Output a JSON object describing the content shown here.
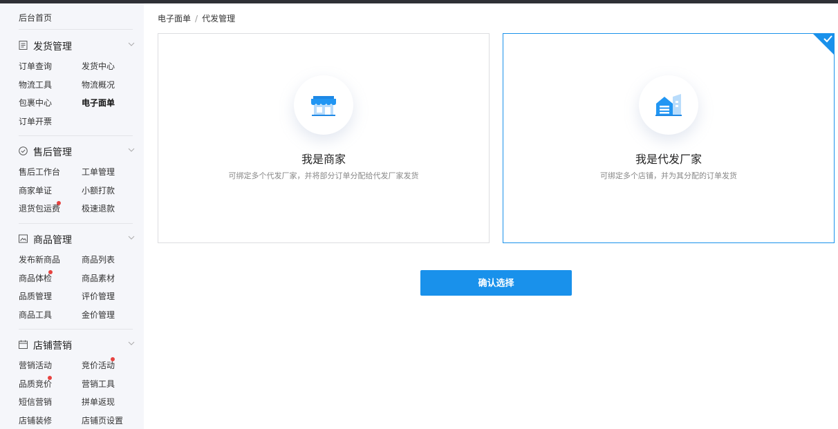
{
  "sidebar": {
    "home": "后台首页",
    "sections": [
      {
        "title": "发货管理",
        "icon": "document-icon",
        "items": [
          "订单查询",
          "发货中心",
          "物流工具",
          "物流概况",
          "包裹中心",
          "电子面单",
          "订单开票"
        ]
      },
      {
        "title": "售后管理",
        "icon": "shield-check-icon",
        "items": [
          "售后工作台",
          "工单管理",
          "商家单证",
          "小额打款",
          "退货包运费",
          "极速退款"
        ]
      },
      {
        "title": "商品管理",
        "icon": "image-icon",
        "items": [
          "发布新商品",
          "商品列表",
          "商品体检",
          "商品素材",
          "品质管理",
          "评价管理",
          "商品工具",
          "金价管理"
        ]
      },
      {
        "title": "店铺营销",
        "icon": "calendar-icon",
        "items": [
          "营销活动",
          "竞价活动",
          "品质竞价",
          "营销工具",
          "短信营销",
          "拼单返现",
          "店铺装修",
          "店铺页设置"
        ]
      }
    ],
    "active_item": "电子面单"
  },
  "breadcrumb": {
    "parent": "电子面单",
    "separator": "/",
    "current": "代发管理"
  },
  "cards": [
    {
      "title": "我是商家",
      "desc": "可绑定多个代发厂家，并将部分订单分配给代发厂家发货",
      "icon": "store-icon",
      "selected": false
    },
    {
      "title": "我是代发厂家",
      "desc": "可绑定多个店铺，并为其分配的订单发货",
      "icon": "factory-icon",
      "selected": true
    }
  ],
  "confirm_button": "确认选择",
  "colors": {
    "accent": "#1991eb",
    "sidebar_bg": "#f5f6fa",
    "badge": "#e64340"
  }
}
